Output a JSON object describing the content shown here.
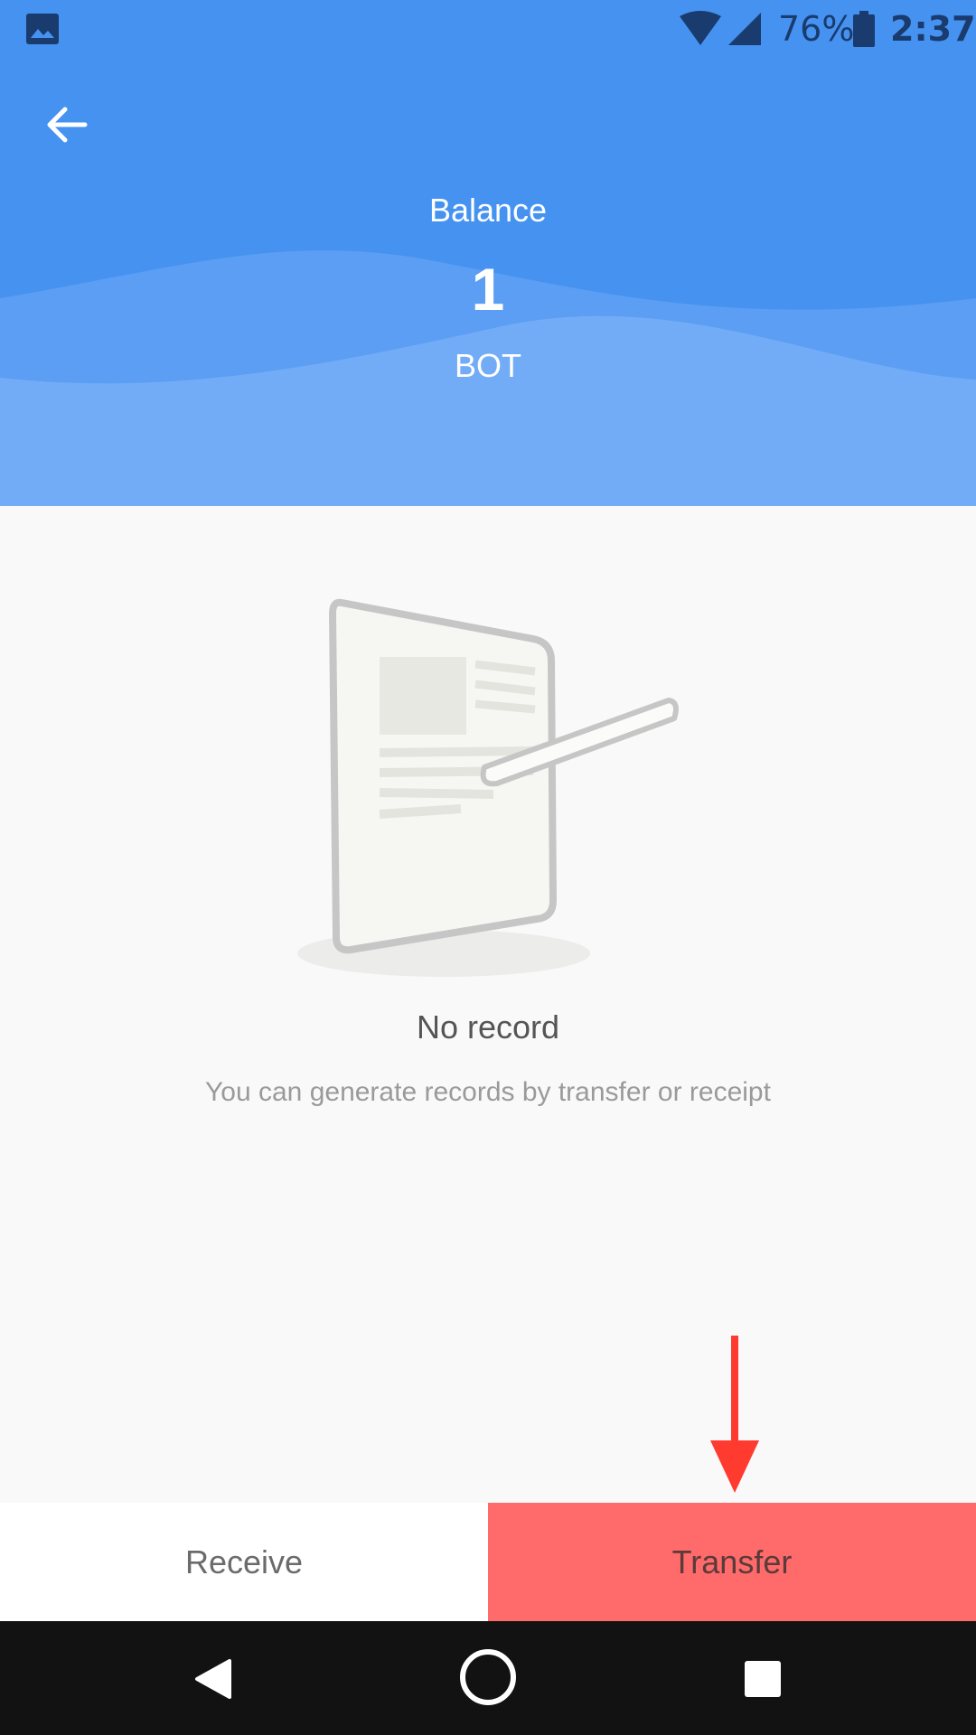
{
  "status_bar": {
    "battery_text": "76%",
    "time": "2:37",
    "icons": [
      "gallery-icon",
      "wifi-icon",
      "signal-icon",
      "battery-icon"
    ]
  },
  "header": {
    "back_icon": "arrow-left-icon",
    "balance_title": "Balance",
    "balance_amount": "1",
    "balance_unit": "BOT"
  },
  "empty_state": {
    "illustration_icon": "document-pencil-icon",
    "title": "No record",
    "description": "You can generate records by transfer or receipt"
  },
  "actions": {
    "receive_label": "Receive",
    "transfer_label": "Transfer"
  },
  "nav_bar": {
    "icons": [
      "nav-back-icon",
      "nav-home-icon",
      "nav-recents-icon"
    ]
  },
  "colors": {
    "header_blue": "#4592f1",
    "header_light_blue": "#72acf6",
    "transfer_red": "#ff6a6a",
    "annotation_red": "#ff3b30",
    "background": "#f9f9f9",
    "navbar": "#121212"
  }
}
